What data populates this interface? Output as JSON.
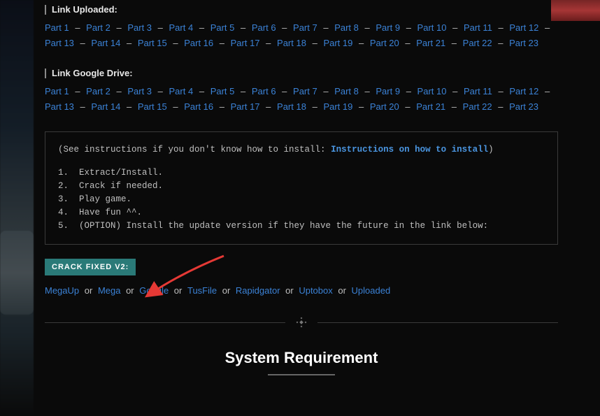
{
  "uploaded": {
    "heading": "Link Uploaded:",
    "part_prefix": "Part ",
    "count": 23
  },
  "gdrive": {
    "heading": "Link Google Drive:",
    "part_prefix": "Part ",
    "count": 23
  },
  "code": {
    "pre_text": "(See instructions if you don't know how to install: ",
    "link_text": "Instructions on how to install",
    "post_text": ")",
    "steps": [
      "Extract/Install.",
      "Crack if needed.",
      "Play game.",
      "Have fun ^^.",
      "(OPTION) Install the update version if they have the future in the link below:"
    ]
  },
  "crack": {
    "badge": "CRACK FIXED V2:",
    "providers": [
      "MegaUp",
      "Mega",
      "Google",
      "TusFile",
      "Rapidgator",
      "Uptobox",
      "Uploaded"
    ],
    "or": "or"
  },
  "sys_req": {
    "title": "System Requirement"
  },
  "sep": " – "
}
